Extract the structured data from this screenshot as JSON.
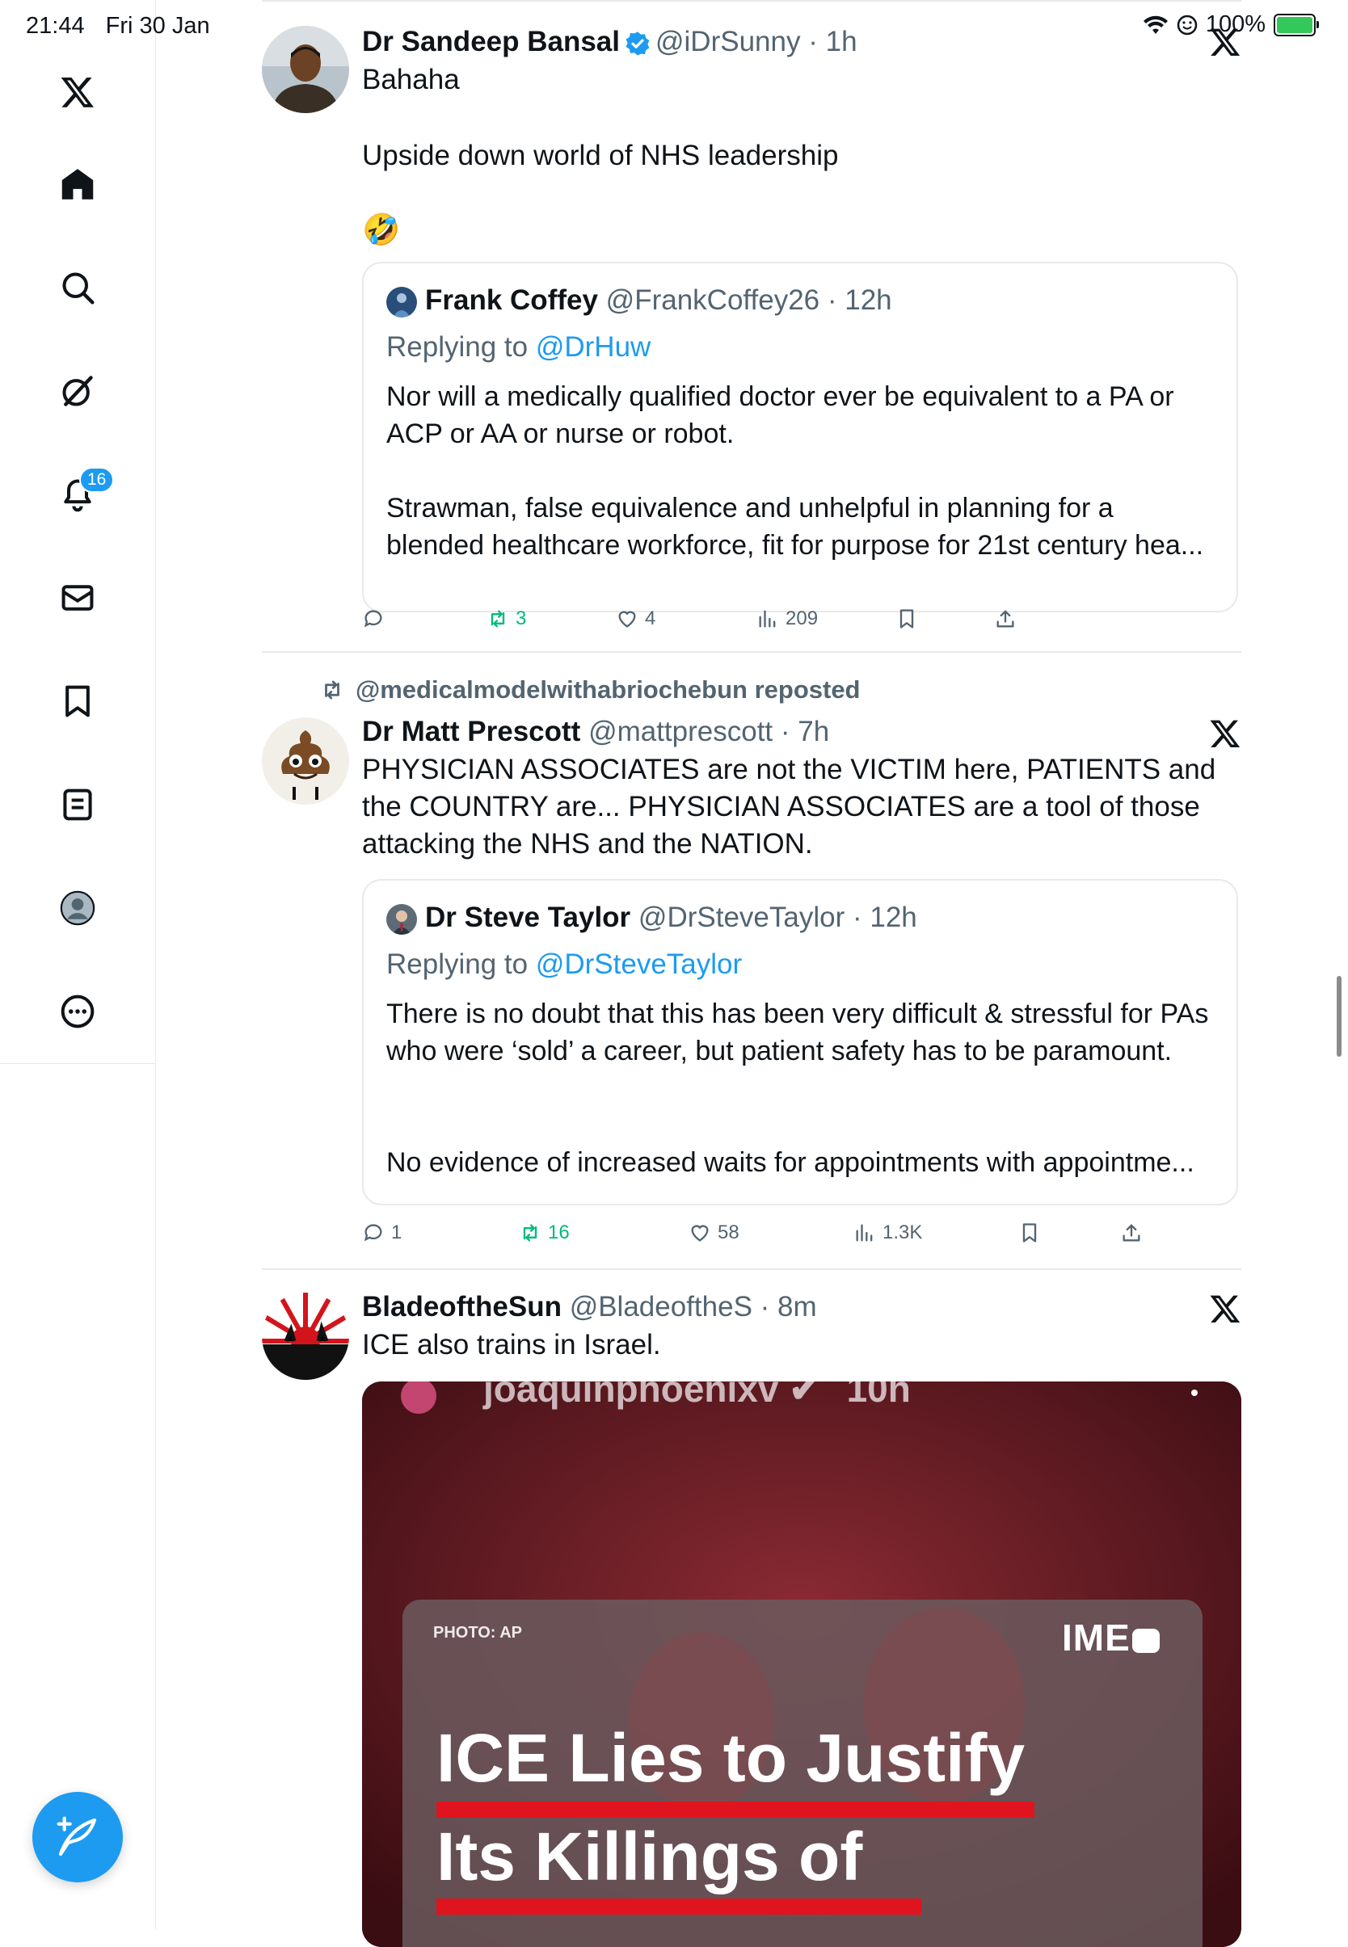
{
  "status_bar": {
    "time": "21:44",
    "date": "Fri 30 Jan",
    "battery": "100%"
  },
  "sidebar": {
    "items": [
      {
        "icon": "x-logo-icon"
      },
      {
        "icon": "home-icon"
      },
      {
        "icon": "search-icon"
      },
      {
        "icon": "grok-icon"
      },
      {
        "icon": "bell-icon"
      },
      {
        "icon": "mail-icon"
      },
      {
        "icon": "bookmark-icon"
      },
      {
        "icon": "list-icon"
      },
      {
        "icon": "profile-icon"
      },
      {
        "icon": "more-icon"
      }
    ],
    "notifications_count": "16",
    "compose_icon": "compose-icon"
  },
  "posts": [
    {
      "name": "Dr Sandeep Bansal",
      "handle": "@iDrSunny",
      "time": "· 1h",
      "text1": "Bahaha",
      "text2": "Upside down world of NHS leadership",
      "emoji": "🤣",
      "quote": {
        "name": "Frank Coffey",
        "handle": "@FrankCoffey26",
        "time": "· 12h",
        "replying_prefix": "Replying to ",
        "replying_to": "@DrHuw",
        "text1": "Nor will a medically qualified doctor ever be equivalent to a PA or ACP or AA or nurse or robot.",
        "text2": "Strawman, false equivalence and unhelpful in planning for a blended healthcare workforce, fit for purpose for 21st century hea..."
      },
      "actions": {
        "replies": "",
        "reposts": "3",
        "likes": "4",
        "views": "209"
      }
    },
    {
      "repost_by": "@medicalmodelwithabriochebun reposted",
      "name": "Dr Matt Prescott",
      "handle": "@mattprescott",
      "time": "· 7h",
      "text": "PHYSICIAN ASSOCIATES are not the VICTIM here, PATIENTS and the COUNTRY are... PHYSICIAN ASSOCIATES are a tool of those attacking the NHS and the NATION.",
      "quote": {
        "name": "Dr Steve Taylor",
        "handle": "@DrSteveTaylor",
        "time": "· 12h",
        "replying_prefix": "Replying to ",
        "replying_to": "@DrSteveTaylor",
        "text1": "There is no doubt that this has been very difficult & stressful for PAs who were ‘sold’ a career, but patient safety has to be paramount.",
        "text2": "No evidence of increased waits for appointments with appointme..."
      },
      "actions": {
        "replies": "1",
        "reposts": "16",
        "likes": "58",
        "views": "1.3K"
      }
    },
    {
      "name": "BladeoftheSun",
      "handle": "@BladeoftheS",
      "time": "· 8m",
      "text": "ICE also trains in Israel.",
      "media": {
        "top_text": "joaquinphoenixv",
        "top_time": "10h",
        "photo_credit": "PHOTO: AP",
        "brand": "IME",
        "headline1": "ICE Lies to Justify",
        "headline2": "Its Killings of"
      }
    }
  ]
}
